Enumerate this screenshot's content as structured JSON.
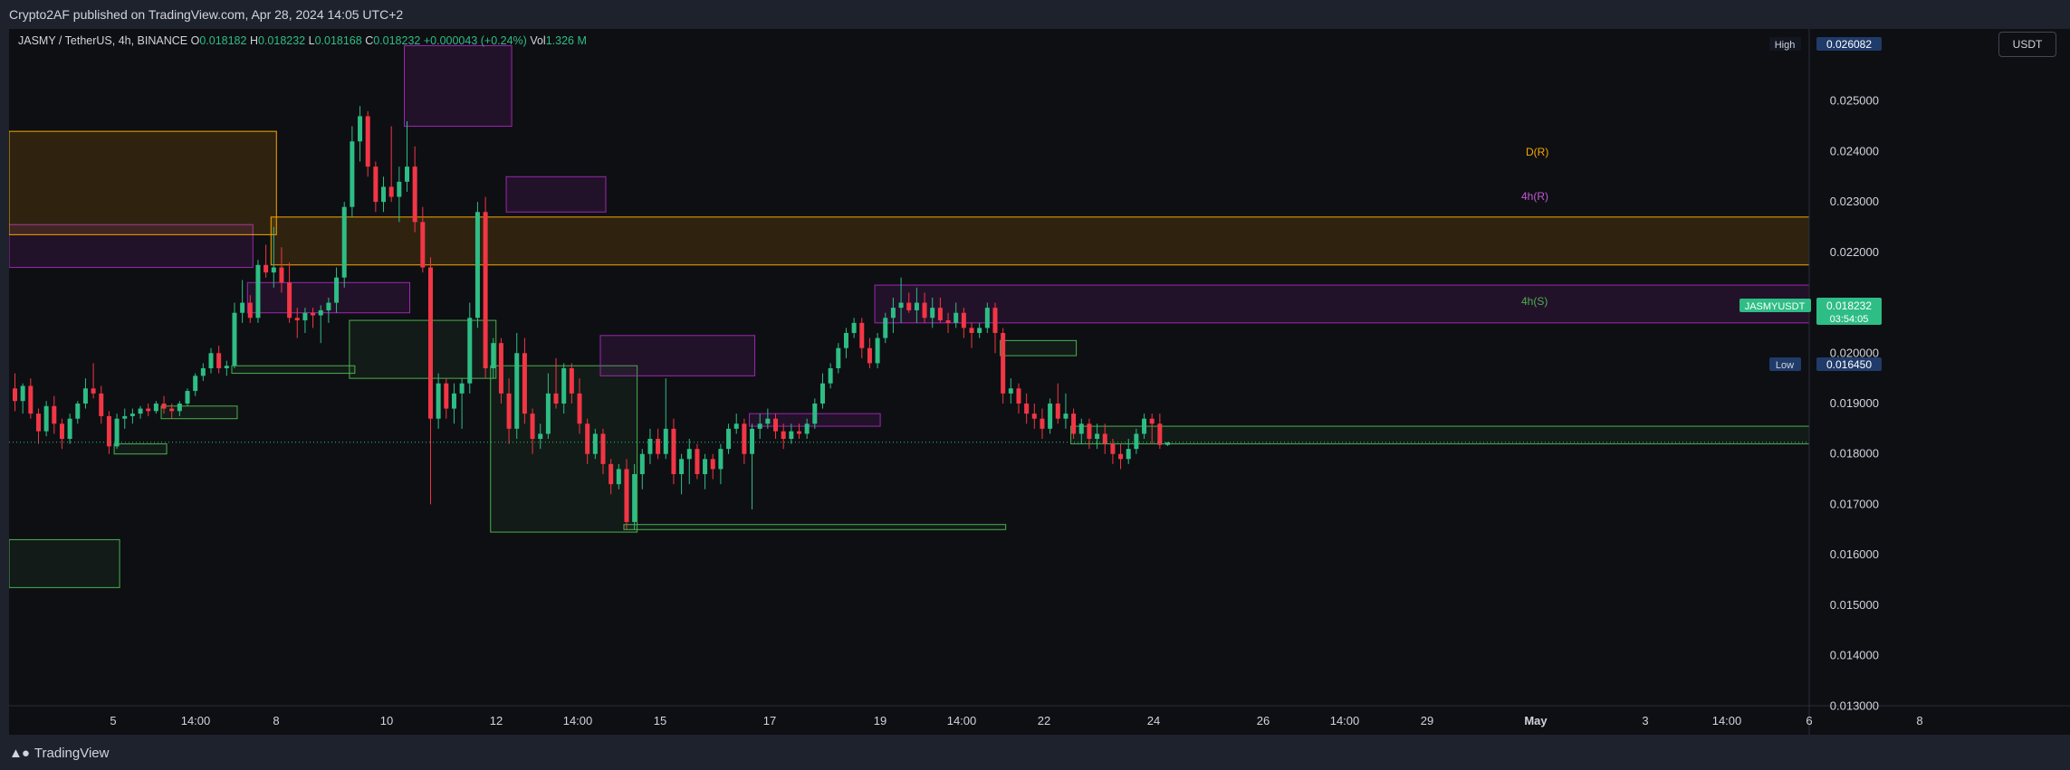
{
  "header": {
    "published": "Crypto2AF published on TradingView.com, Apr 28, 2024 14:05 UTC+2"
  },
  "legend": {
    "symbol": "JASMY / TetherUS, 4h, BINANCE",
    "o_label": "O",
    "o": "0.018182",
    "h_label": "H",
    "h": "0.018232",
    "l_label": "L",
    "l": "0.018168",
    "c_label": "C",
    "c": "0.018232",
    "change": "+0.000043 (+0.24%)",
    "vol_label": "Vol",
    "vol": "1.326 M"
  },
  "price_axis": {
    "unit": "USDT",
    "ticks": [
      "0.026082",
      "0.025000",
      "0.024000",
      "0.023000",
      "0.022000",
      "0.021000",
      "0.020000",
      "0.019000",
      "0.018000",
      "0.017000",
      "0.016000",
      "0.015000",
      "0.014000",
      "0.013000"
    ],
    "high_label": "High",
    "high_value": "0.026082",
    "low_label": "Low",
    "low_value": "0.016450",
    "symbol_tag": "JASMYUSDT",
    "last_price": "0.018232",
    "countdown": "03:54:05"
  },
  "time_axis": {
    "ticks": [
      "5",
      "14:00",
      "8",
      "10",
      "12",
      "14:00",
      "15",
      "17",
      "19",
      "14:00",
      "22",
      "24",
      "26",
      "14:00",
      "29",
      "May",
      "3",
      "14:00",
      "6",
      "8"
    ]
  },
  "zone_labels": {
    "daily_resistance": "D(R)",
    "h4_resistance": "4h(R)",
    "h4_support": "4h(S)"
  },
  "footer": {
    "brand": "TradingView"
  },
  "colors": {
    "up": "#2ebd85",
    "down": "#f23645",
    "daily_zone": "#f7a600",
    "resistance_zone": "#9c27b0",
    "support_zone": "#4caf50"
  },
  "chart_data": {
    "type": "candlestick",
    "title": "JASMY / TetherUS, 4h, BINANCE",
    "ylim": [
      0.0127,
      0.0267
    ],
    "candles": [
      [
        0.0193,
        0.0196,
        0.01885,
        0.01905
      ],
      [
        0.01905,
        0.0194,
        0.0188,
        0.01935
      ],
      [
        0.01935,
        0.0195,
        0.0187,
        0.0188
      ],
      [
        0.0188,
        0.0189,
        0.0182,
        0.01845
      ],
      [
        0.01845,
        0.01905,
        0.01835,
        0.01895
      ],
      [
        0.01895,
        0.01915,
        0.0184,
        0.0186
      ],
      [
        0.0186,
        0.0187,
        0.0181,
        0.0183
      ],
      [
        0.0183,
        0.0188,
        0.0182,
        0.0187
      ],
      [
        0.0187,
        0.01905,
        0.0186,
        0.019
      ],
      [
        0.019,
        0.0195,
        0.0189,
        0.0193
      ],
      [
        0.0193,
        0.0198,
        0.0191,
        0.0192
      ],
      [
        0.0192,
        0.01935,
        0.0186,
        0.01875
      ],
      [
        0.01875,
        0.01885,
        0.018,
        0.01815
      ],
      [
        0.01815,
        0.0188,
        0.0181,
        0.0187
      ],
      [
        0.0187,
        0.0189,
        0.0185,
        0.01875
      ],
      [
        0.01875,
        0.0189,
        0.0186,
        0.0188
      ],
      [
        0.0188,
        0.01895,
        0.0187,
        0.0189
      ],
      [
        0.0189,
        0.019,
        0.01875,
        0.01885
      ],
      [
        0.01885,
        0.01905,
        0.0188,
        0.019
      ],
      [
        0.019,
        0.01915,
        0.0188,
        0.0189
      ],
      [
        0.0189,
        0.019,
        0.0187,
        0.01885
      ],
      [
        0.01885,
        0.01905,
        0.01875,
        0.019
      ],
      [
        0.019,
        0.0193,
        0.01895,
        0.01925
      ],
      [
        0.01925,
        0.0196,
        0.01915,
        0.01955
      ],
      [
        0.01955,
        0.0198,
        0.01945,
        0.0197
      ],
      [
        0.0197,
        0.0201,
        0.0196,
        0.02
      ],
      [
        0.02,
        0.02015,
        0.0196,
        0.0197
      ],
      [
        0.0197,
        0.01985,
        0.01955,
        0.01975
      ],
      [
        0.01975,
        0.021,
        0.0197,
        0.0208
      ],
      [
        0.0208,
        0.02145,
        0.0206,
        0.021
      ],
      [
        0.021,
        0.02115,
        0.0206,
        0.0207
      ],
      [
        0.0207,
        0.02185,
        0.0206,
        0.02175
      ],
      [
        0.02175,
        0.02215,
        0.0215,
        0.0216
      ],
      [
        0.0216,
        0.0225,
        0.0213,
        0.0217
      ],
      [
        0.0217,
        0.0221,
        0.0212,
        0.0214
      ],
      [
        0.0214,
        0.0218,
        0.0206,
        0.0207
      ],
      [
        0.0207,
        0.0209,
        0.0203,
        0.02065
      ],
      [
        0.02065,
        0.0209,
        0.0204,
        0.0208
      ],
      [
        0.0208,
        0.0209,
        0.0205,
        0.02075
      ],
      [
        0.02075,
        0.02095,
        0.0202,
        0.02085
      ],
      [
        0.02085,
        0.0211,
        0.0206,
        0.021
      ],
      [
        0.021,
        0.0217,
        0.0208,
        0.0215
      ],
      [
        0.0215,
        0.023,
        0.0213,
        0.0229
      ],
      [
        0.0229,
        0.0245,
        0.0227,
        0.0242
      ],
      [
        0.0242,
        0.0249,
        0.0238,
        0.0247
      ],
      [
        0.0247,
        0.0248,
        0.0235,
        0.0237
      ],
      [
        0.0237,
        0.0238,
        0.0228,
        0.023
      ],
      [
        0.023,
        0.0235,
        0.0228,
        0.0233
      ],
      [
        0.0233,
        0.0245,
        0.023,
        0.0231
      ],
      [
        0.0231,
        0.0237,
        0.0226,
        0.0234
      ],
      [
        0.0234,
        0.0246,
        0.0232,
        0.0237
      ],
      [
        0.0237,
        0.0241,
        0.0224,
        0.0226
      ],
      [
        0.0226,
        0.0229,
        0.0216,
        0.0217
      ],
      [
        0.0217,
        0.0219,
        0.017,
        0.0187
      ],
      [
        0.0187,
        0.0196,
        0.0185,
        0.0194
      ],
      [
        0.0194,
        0.0195,
        0.0187,
        0.0189
      ],
      [
        0.0189,
        0.0194,
        0.0186,
        0.0192
      ],
      [
        0.0192,
        0.0195,
        0.0185,
        0.0194
      ],
      [
        0.0194,
        0.021,
        0.0192,
        0.0207
      ],
      [
        0.0207,
        0.023,
        0.0205,
        0.0228
      ],
      [
        0.0228,
        0.0231,
        0.0195,
        0.0197
      ],
      [
        0.0197,
        0.0203,
        0.0195,
        0.0202
      ],
      [
        0.0202,
        0.0203,
        0.019,
        0.0192
      ],
      [
        0.0192,
        0.0195,
        0.0182,
        0.0185
      ],
      [
        0.0185,
        0.0204,
        0.0183,
        0.02
      ],
      [
        0.02,
        0.0203,
        0.0186,
        0.0188
      ],
      [
        0.0188,
        0.0189,
        0.018,
        0.0183
      ],
      [
        0.0183,
        0.0186,
        0.0181,
        0.0184
      ],
      [
        0.0184,
        0.0196,
        0.0183,
        0.0192
      ],
      [
        0.0192,
        0.0199,
        0.0189,
        0.019
      ],
      [
        0.019,
        0.0198,
        0.0188,
        0.0197
      ],
      [
        0.0197,
        0.0198,
        0.019,
        0.0192
      ],
      [
        0.0192,
        0.0195,
        0.0184,
        0.0186
      ],
      [
        0.0186,
        0.0187,
        0.0178,
        0.018
      ],
      [
        0.018,
        0.0185,
        0.0179,
        0.0184
      ],
      [
        0.0184,
        0.0185,
        0.0176,
        0.0178
      ],
      [
        0.0178,
        0.0179,
        0.0172,
        0.0174
      ],
      [
        0.0174,
        0.0178,
        0.0173,
        0.0177
      ],
      [
        0.0177,
        0.0179,
        0.0165,
        0.01665
      ],
      [
        0.01665,
        0.0178,
        0.0165,
        0.0176
      ],
      [
        0.0176,
        0.0181,
        0.0173,
        0.018
      ],
      [
        0.018,
        0.0185,
        0.0178,
        0.0183
      ],
      [
        0.0183,
        0.0185,
        0.0179,
        0.018
      ],
      [
        0.018,
        0.0195,
        0.0179,
        0.0185
      ],
      [
        0.0185,
        0.0187,
        0.0174,
        0.0176
      ],
      [
        0.0176,
        0.018,
        0.0172,
        0.0179
      ],
      [
        0.0179,
        0.0183,
        0.0174,
        0.0181
      ],
      [
        0.0181,
        0.0182,
        0.0175,
        0.0176
      ],
      [
        0.0176,
        0.018,
        0.0173,
        0.0179
      ],
      [
        0.0179,
        0.018,
        0.0175,
        0.0177
      ],
      [
        0.0177,
        0.0182,
        0.0174,
        0.0181
      ],
      [
        0.0181,
        0.0186,
        0.018,
        0.0185
      ],
      [
        0.0185,
        0.0188,
        0.0184,
        0.0186
      ],
      [
        0.0186,
        0.0187,
        0.0178,
        0.018
      ],
      [
        0.018,
        0.0186,
        0.0169,
        0.0185
      ],
      [
        0.0185,
        0.0188,
        0.0183,
        0.0186
      ],
      [
        0.0186,
        0.0189,
        0.0185,
        0.0187
      ],
      [
        0.0187,
        0.0188,
        0.0183,
        0.01845
      ],
      [
        0.01845,
        0.0186,
        0.0181,
        0.0183
      ],
      [
        0.0183,
        0.0186,
        0.0182,
        0.01845
      ],
      [
        0.01845,
        0.0186,
        0.0183,
        0.0184
      ],
      [
        0.0184,
        0.0187,
        0.0183,
        0.0186
      ],
      [
        0.0186,
        0.0191,
        0.0185,
        0.019
      ],
      [
        0.019,
        0.0196,
        0.0189,
        0.0194
      ],
      [
        0.0194,
        0.0198,
        0.0193,
        0.0197
      ],
      [
        0.0197,
        0.0202,
        0.0196,
        0.0201
      ],
      [
        0.0201,
        0.0205,
        0.0199,
        0.0204
      ],
      [
        0.0204,
        0.0207,
        0.0203,
        0.0206
      ],
      [
        0.0206,
        0.0207,
        0.0199,
        0.0201
      ],
      [
        0.0201,
        0.0203,
        0.0197,
        0.0198
      ],
      [
        0.0198,
        0.0204,
        0.0197,
        0.0203
      ],
      [
        0.0203,
        0.0208,
        0.0202,
        0.0207
      ],
      [
        0.0207,
        0.0211,
        0.0204,
        0.0209
      ],
      [
        0.0209,
        0.0215,
        0.0206,
        0.021
      ],
      [
        0.021,
        0.0212,
        0.0208,
        0.02085
      ],
      [
        0.02085,
        0.0213,
        0.0206,
        0.021
      ],
      [
        0.021,
        0.0212,
        0.0206,
        0.0207
      ],
      [
        0.0207,
        0.0211,
        0.0205,
        0.0209
      ],
      [
        0.0209,
        0.0211,
        0.0206,
        0.02065
      ],
      [
        0.02065,
        0.0208,
        0.0204,
        0.0206
      ],
      [
        0.0206,
        0.021,
        0.0205,
        0.0208
      ],
      [
        0.0208,
        0.0209,
        0.0203,
        0.0205
      ],
      [
        0.0205,
        0.0206,
        0.0201,
        0.0204
      ],
      [
        0.0204,
        0.0206,
        0.0203,
        0.0205
      ],
      [
        0.0205,
        0.021,
        0.0204,
        0.0209
      ],
      [
        0.0209,
        0.021,
        0.02,
        0.0204
      ],
      [
        0.0204,
        0.0205,
        0.019,
        0.0192
      ],
      [
        0.0192,
        0.0195,
        0.019,
        0.0193
      ],
      [
        0.0193,
        0.0194,
        0.0188,
        0.019
      ],
      [
        0.019,
        0.0192,
        0.0186,
        0.0188
      ],
      [
        0.0188,
        0.019,
        0.0185,
        0.0187
      ],
      [
        0.0187,
        0.0189,
        0.0183,
        0.0185
      ],
      [
        0.0185,
        0.0191,
        0.0184,
        0.019
      ],
      [
        0.019,
        0.0194,
        0.0186,
        0.0187
      ],
      [
        0.0187,
        0.0192,
        0.0185,
        0.0188
      ],
      [
        0.0188,
        0.0189,
        0.0183,
        0.0184
      ],
      [
        0.0184,
        0.0187,
        0.0182,
        0.0186
      ],
      [
        0.0186,
        0.0187,
        0.0181,
        0.0183
      ],
      [
        0.0183,
        0.0186,
        0.0181,
        0.0184
      ],
      [
        0.0184,
        0.0186,
        0.018,
        0.0182
      ],
      [
        0.0182,
        0.0183,
        0.0178,
        0.018
      ],
      [
        0.018,
        0.0182,
        0.0177,
        0.0179
      ],
      [
        0.0179,
        0.0183,
        0.0178,
        0.0181
      ],
      [
        0.0181,
        0.0185,
        0.018,
        0.0184
      ],
      [
        0.0184,
        0.0188,
        0.0183,
        0.0187
      ],
      [
        0.0187,
        0.0188,
        0.0182,
        0.0186
      ],
      [
        0.0186,
        0.0188,
        0.0181,
        0.01818
      ],
      [
        0.01818,
        0.01823,
        0.01816,
        0.01823
      ]
    ],
    "zones": [
      {
        "kind": "support",
        "x0": 0,
        "x1": 13,
        "y0": 0.0163,
        "y1": 0.01535
      },
      {
        "kind": "support",
        "x0": 13,
        "x1": 19,
        "y0": 0.0182,
        "y1": 0.018
      },
      {
        "kind": "support",
        "x0": 19,
        "x1": 28,
        "y0": 0.01895,
        "y1": 0.0187
      },
      {
        "kind": "support",
        "x0": 28,
        "x1": 43,
        "y0": 0.01975,
        "y1": 0.0196
      },
      {
        "kind": "support",
        "x0": 43,
        "x1": 61,
        "y0": 0.02065,
        "y1": 0.0195
      },
      {
        "kind": "support",
        "x0": 61,
        "x1": 79,
        "y0": 0.01975,
        "y1": 0.01645
      },
      {
        "kind": "support",
        "x0": 78,
        "x1": 126,
        "y0": 0.0166,
        "y1": 0.0165
      },
      {
        "kind": "support",
        "x0": 126,
        "x1": 135,
        "y0": 0.02025,
        "y1": 0.01995
      },
      {
        "kind": "resistance",
        "x0": 0,
        "x1": 30,
        "y0": 0.02255,
        "y1": 0.0217
      },
      {
        "kind": "resistance",
        "x0": 30,
        "x1": 50,
        "y0": 0.0214,
        "y1": 0.0208
      },
      {
        "kind": "resistance",
        "x0": 50,
        "x1": 63,
        "y0": 0.0261,
        "y1": 0.0245
      },
      {
        "kind": "resistance",
        "x0": 63,
        "x1": 75,
        "y0": 0.0235,
        "y1": 0.0228
      },
      {
        "kind": "resistance",
        "x0": 75,
        "x1": 94,
        "y0": 0.02035,
        "y1": 0.01955
      },
      {
        "kind": "resistance",
        "x0": 94,
        "x1": 110,
        "y0": 0.0188,
        "y1": 0.01855
      },
      {
        "kind": "daily",
        "x0": 0,
        "x1": 33,
        "y0": 0.0244,
        "y1": 0.02235
      },
      {
        "kind": "daily",
        "x0": 33,
        "x1": null,
        "y0": 0.0227,
        "y1": 0.02175
      },
      {
        "kind": "resistance",
        "x0": 110,
        "x1": null,
        "y0": 0.02135,
        "y1": 0.0206
      },
      {
        "kind": "support",
        "x0": 135,
        "x1": null,
        "y0": 0.01855,
        "y1": 0.0182
      }
    ],
    "high": 0.026082,
    "low": 0.01645,
    "last": 0.018232
  }
}
